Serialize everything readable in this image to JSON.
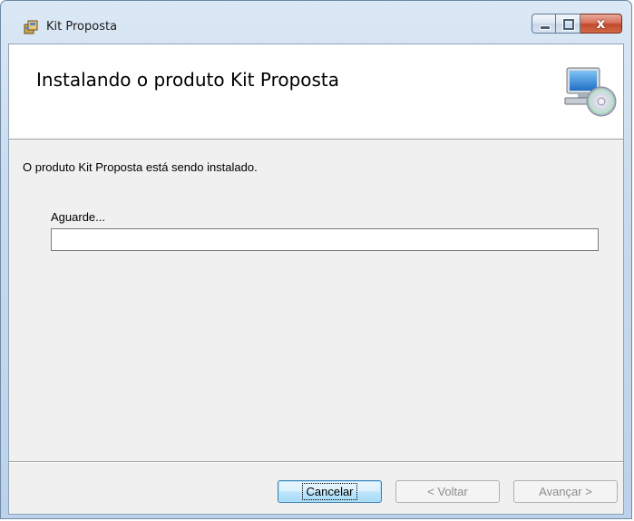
{
  "window": {
    "title": "Kit Proposta",
    "close_glyph": "x",
    "icons": {
      "app": "installer-package-icon",
      "minimize": "minimize-icon",
      "maximize": "maximize-icon",
      "close": "close-icon"
    }
  },
  "banner": {
    "title": "Instalando o produto Kit Proposta",
    "icon": "computer-disc-icon"
  },
  "main": {
    "status": "O produto Kit Proposta está sendo instalado.",
    "wait_label": "Aguarde...",
    "progress": 0
  },
  "buttons": {
    "cancel": "Cancelar",
    "back": "< Voltar",
    "next": "Avançar >"
  },
  "colors": {
    "accent": "#3c7fb1",
    "close_button": "#c14a2e",
    "disabled_text": "#8d8d8d"
  }
}
